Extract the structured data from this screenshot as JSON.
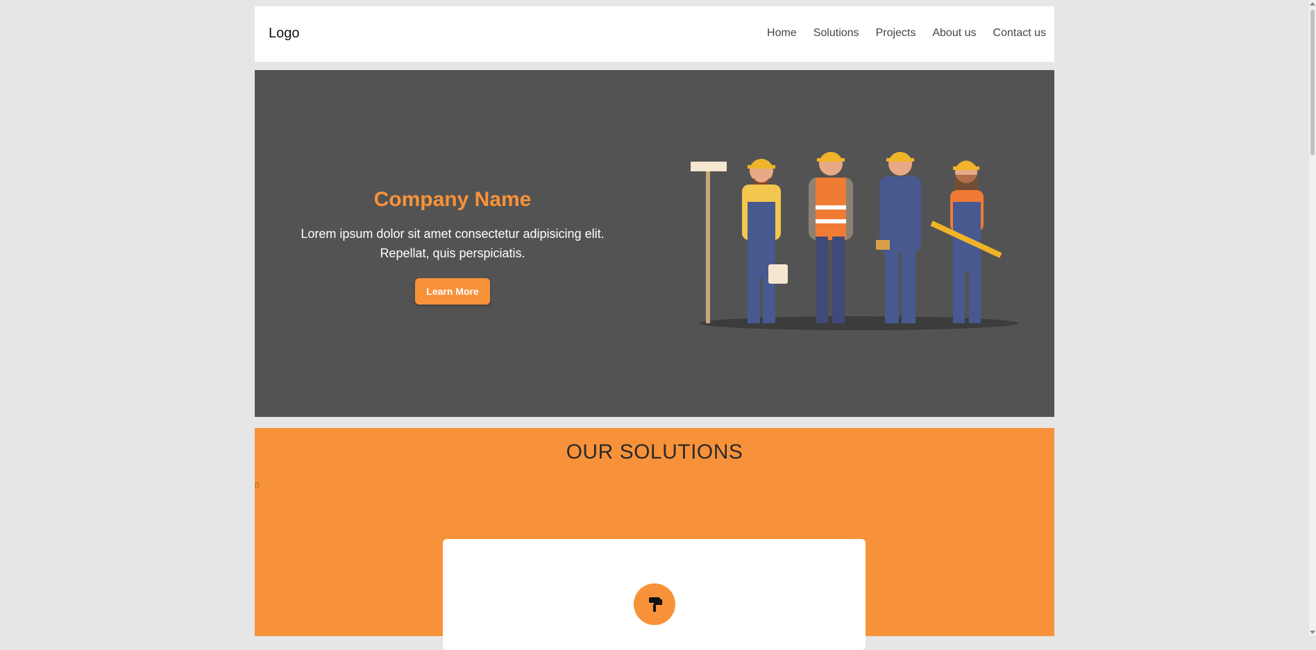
{
  "nav": {
    "logo": "Logo",
    "links": [
      "Home",
      "Solutions",
      "Projects",
      "About us",
      "Contact us"
    ]
  },
  "hero": {
    "title": "Company Name",
    "description": "Lorem ipsum dolor sit amet consectetur adipisicing elit. Repellat, quis perspiciatis.",
    "cta_label": "Learn More",
    "illustration": "construction-workers-illustration"
  },
  "solutions": {
    "title": "OUR SOLUTIONS",
    "stray_text": "0",
    "card_icon": "paint-roller-icon"
  },
  "colors": {
    "accent": "#f8923a",
    "hero_bg": "#535353",
    "page_bg": "#e6e6e6"
  }
}
